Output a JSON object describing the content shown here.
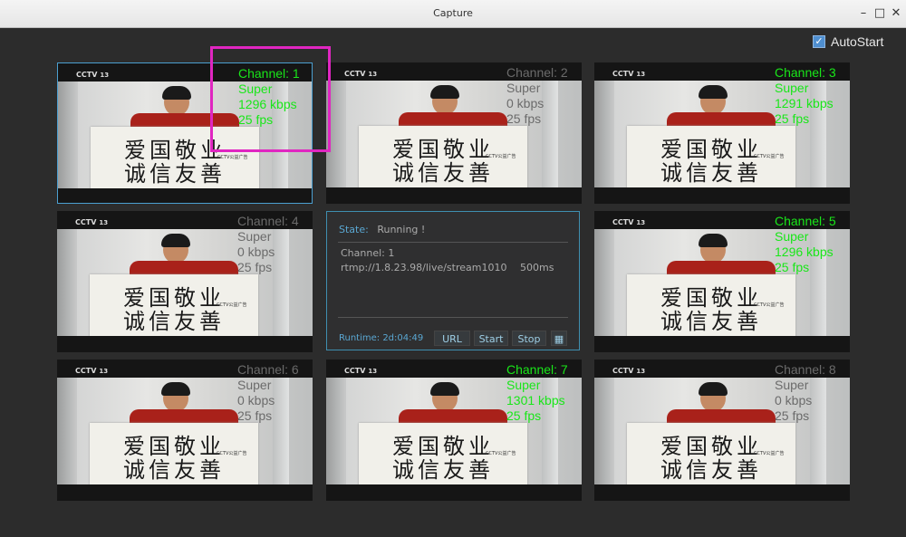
{
  "window": {
    "title": "Capture",
    "minimize": "–",
    "maximize": "□",
    "close": "✕"
  },
  "autostart": {
    "label": "AutoStart",
    "checked": true
  },
  "tiles": [
    {
      "channel": "Channel: 1",
      "quality": "Super",
      "bitrate": "1296 kbps",
      "fps": "25 fps",
      "active": true,
      "selected": true
    },
    {
      "channel": "Channel: 2",
      "quality": "Super",
      "bitrate": "0 kbps",
      "fps": "25 fps",
      "active": false,
      "selected": false
    },
    {
      "channel": "Channel: 3",
      "quality": "Super",
      "bitrate": "1291 kbps",
      "fps": "25 fps",
      "active": true,
      "selected": false
    },
    {
      "channel": "Channel: 4",
      "quality": "Super",
      "bitrate": "0 kbps",
      "fps": "25 fps",
      "active": false,
      "selected": false
    },
    {
      "channel": "Channel: 5",
      "quality": "Super",
      "bitrate": "1296 kbps",
      "fps": "25 fps",
      "active": true,
      "selected": false
    },
    {
      "channel": "Channel: 6",
      "quality": "Super",
      "bitrate": "0 kbps",
      "fps": "25 fps",
      "active": false,
      "selected": false
    },
    {
      "channel": "Channel: 7",
      "quality": "Super",
      "bitrate": "1301 kbps",
      "fps": "25 fps",
      "active": true,
      "selected": false
    },
    {
      "channel": "Channel: 8",
      "quality": "Super",
      "bitrate": "0 kbps",
      "fps": "25 fps",
      "active": false,
      "selected": false
    }
  ],
  "video": {
    "logo": "CCTV",
    "logo_num": "13",
    "line1": "爱国敬业",
    "line2": "诚信友善",
    "stamp": "CCTV公益广告"
  },
  "status_panel": {
    "state_label": "State:",
    "state_value": "Running !",
    "channel": "Channel: 1",
    "url": "rtmp://1.8.23.98/live/stream1010",
    "latency": "500ms",
    "runtime": "Runtime: 2d:04:49",
    "buttons": {
      "url": "URL",
      "start": "Start",
      "stop": "Stop"
    }
  },
  "colors": {
    "active_osd": "#19e619",
    "inactive_osd": "#6b6b6b",
    "highlight": "#e026c1",
    "accent": "#4b9fd0"
  }
}
